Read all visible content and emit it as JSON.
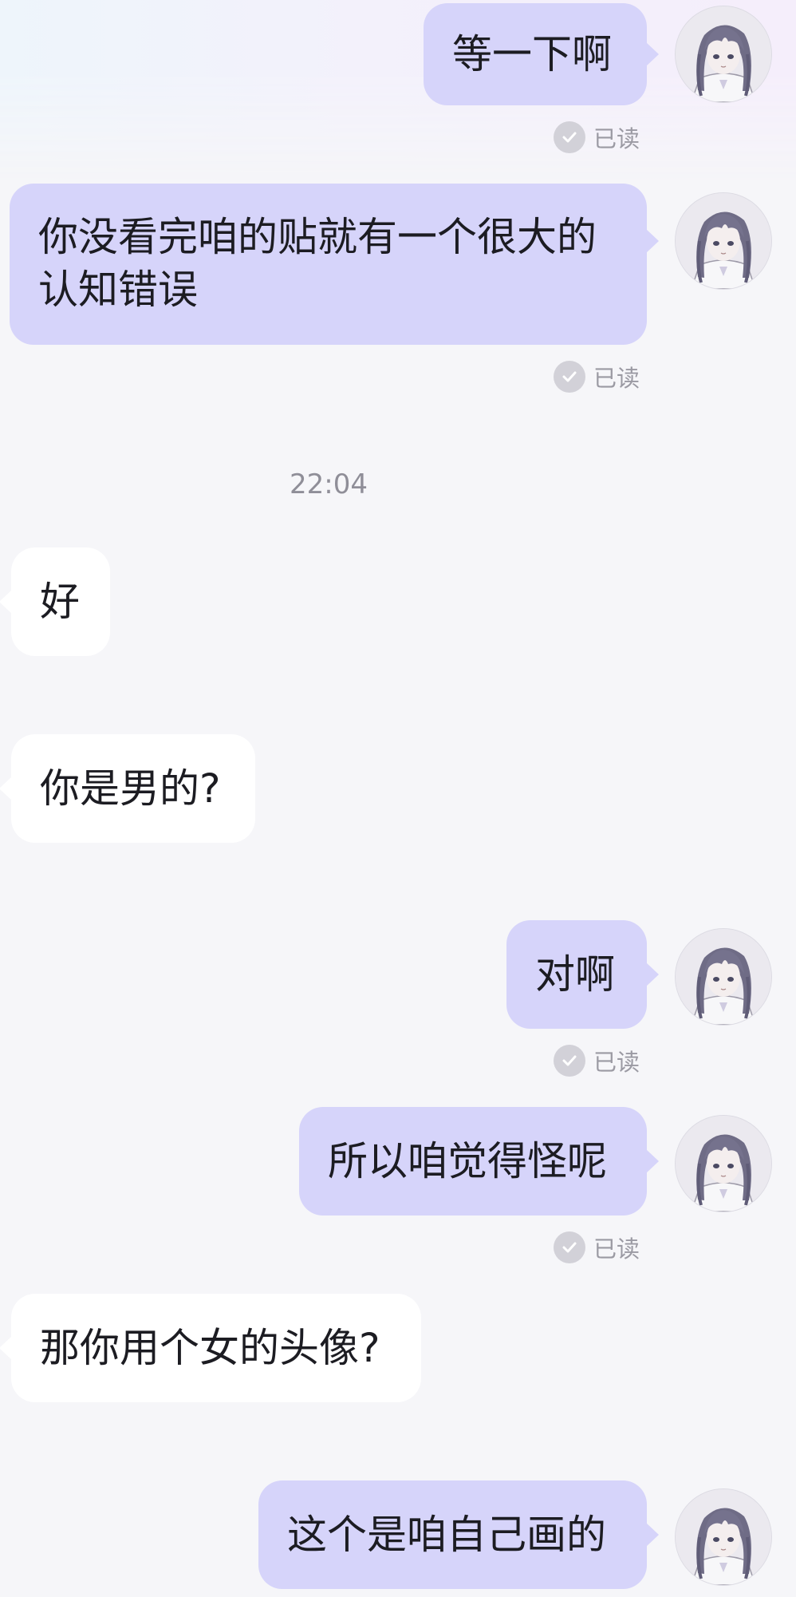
{
  "timestamp": "22:04",
  "read_status": "已读",
  "messages": [
    {
      "sender": "me",
      "text": "等一下啊"
    },
    {
      "sender": "me",
      "text_line1": "你没看完咱的贴就有一个很大的",
      "text_line2": "认知错误"
    },
    {
      "sender": "them",
      "text": "好"
    },
    {
      "sender": "them",
      "text": "你是男的?"
    },
    {
      "sender": "me",
      "text": "对啊"
    },
    {
      "sender": "me",
      "text": "所以咱觉得怪呢"
    },
    {
      "sender": "them",
      "text": "那你用个女的头像?"
    },
    {
      "sender": "me",
      "text": "这个是咱自己画的"
    }
  ],
  "colors": {
    "my_bubble": "#d6d4fa",
    "their_bubble": "#ffffff",
    "background": "#f6f6f9",
    "read_text": "#9b9aa3"
  },
  "icons": {
    "avatar": "anime-girl-avatar",
    "read": "check-circle-icon"
  }
}
